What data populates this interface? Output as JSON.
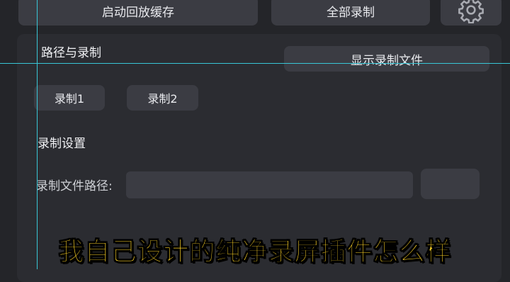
{
  "top_bar": {
    "start_replay_buffer": "启动回放缓存",
    "record_all": "全部录制",
    "settings_icon": "gear-icon"
  },
  "path_section": {
    "title": "路径与录制",
    "show_files_button": "显示录制文件",
    "tabs": [
      "录制1",
      "录制2"
    ]
  },
  "record_settings": {
    "title": "录制设置",
    "file_path_label": "录制文件路径:",
    "file_path_value": ""
  },
  "overlay": {
    "caption": "我自己设计的纯净录屏插件怎么样",
    "guide_color": "#38c6d6",
    "caption_color": "#ffd426"
  }
}
